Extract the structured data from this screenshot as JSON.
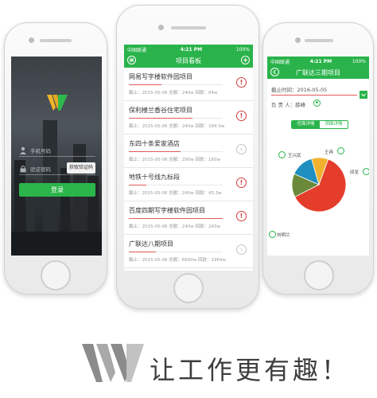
{
  "colors": {
    "brand_green": "#2ab34b",
    "alert_red": "#d23b3b",
    "progress_red": "#e05a5a"
  },
  "login": {
    "phone_placeholder": "手机号码",
    "code_placeholder": "验证密码",
    "sms_button": "获取验证码",
    "login_button": "登录"
  },
  "board": {
    "status": {
      "carrier": "中国联通",
      "time": "4:21 PM",
      "battery": "100%"
    },
    "title": "项目看板",
    "projects": [
      {
        "name": "网易写字楼软件园项目",
        "meta": "截止：2015-05-06  总额：240w  回款：84w",
        "progress": 0.35,
        "status_icon": "alert-icon",
        "icon_glyph": "!"
      },
      {
        "name": "保利楼兰香谷住宅项目",
        "meta": "截止：2015-05-06  总额：240w  回款：164.3w",
        "progress": 0.68,
        "status_icon": "alert-icon",
        "icon_glyph": "!"
      },
      {
        "name": "东四十条爱家酒店",
        "meta": "截止：2015-05-06  总额：290w  回款：160w",
        "progress": 0.55,
        "status_icon": "chevron-right-icon",
        "icon_glyph": "›"
      },
      {
        "name": "地铁十号线九标段",
        "meta": "截止：2015-05-06  总额：240w  回款：45.3w",
        "progress": 0.19,
        "status_icon": "alert-icon",
        "icon_glyph": "!"
      },
      {
        "name": "百度四期写字楼软件园项目",
        "meta": "截止：2015-05-06  总额：240w  回款：243w",
        "progress": 1.0,
        "status_icon": "alert-icon",
        "icon_glyph": "!"
      },
      {
        "name": "广联达八期项目",
        "meta": "截止：2015-05-06  总额：6690w  回款：1964w",
        "progress": 0.29,
        "status_icon": "chevron-right-icon",
        "icon_glyph": "›"
      }
    ]
  },
  "detail": {
    "status": {
      "carrier": "中国联通",
      "time": "4:21 PM",
      "battery": "100%"
    },
    "title": "广联达三期项目",
    "deadline": "截止时间：2016-05-05",
    "owner": "负 责 人：薛峰",
    "tab_active": "任面详情",
    "tab_inactive": "项面详情",
    "chart_data": {
      "type": "pie",
      "slices": [
        {
          "name": "刘明兰",
          "value": 0.62,
          "color": "#e53d2b"
        },
        {
          "name": "邱龙",
          "value": 0.14,
          "color": "#6a8a3a"
        },
        {
          "name": "王冉",
          "value": 0.14,
          "color": "#1e8fbf"
        },
        {
          "name": "王兴武",
          "value": 0.1,
          "color": "#f2b12f"
        }
      ]
    }
  },
  "slogan": "让工作更有趣！"
}
